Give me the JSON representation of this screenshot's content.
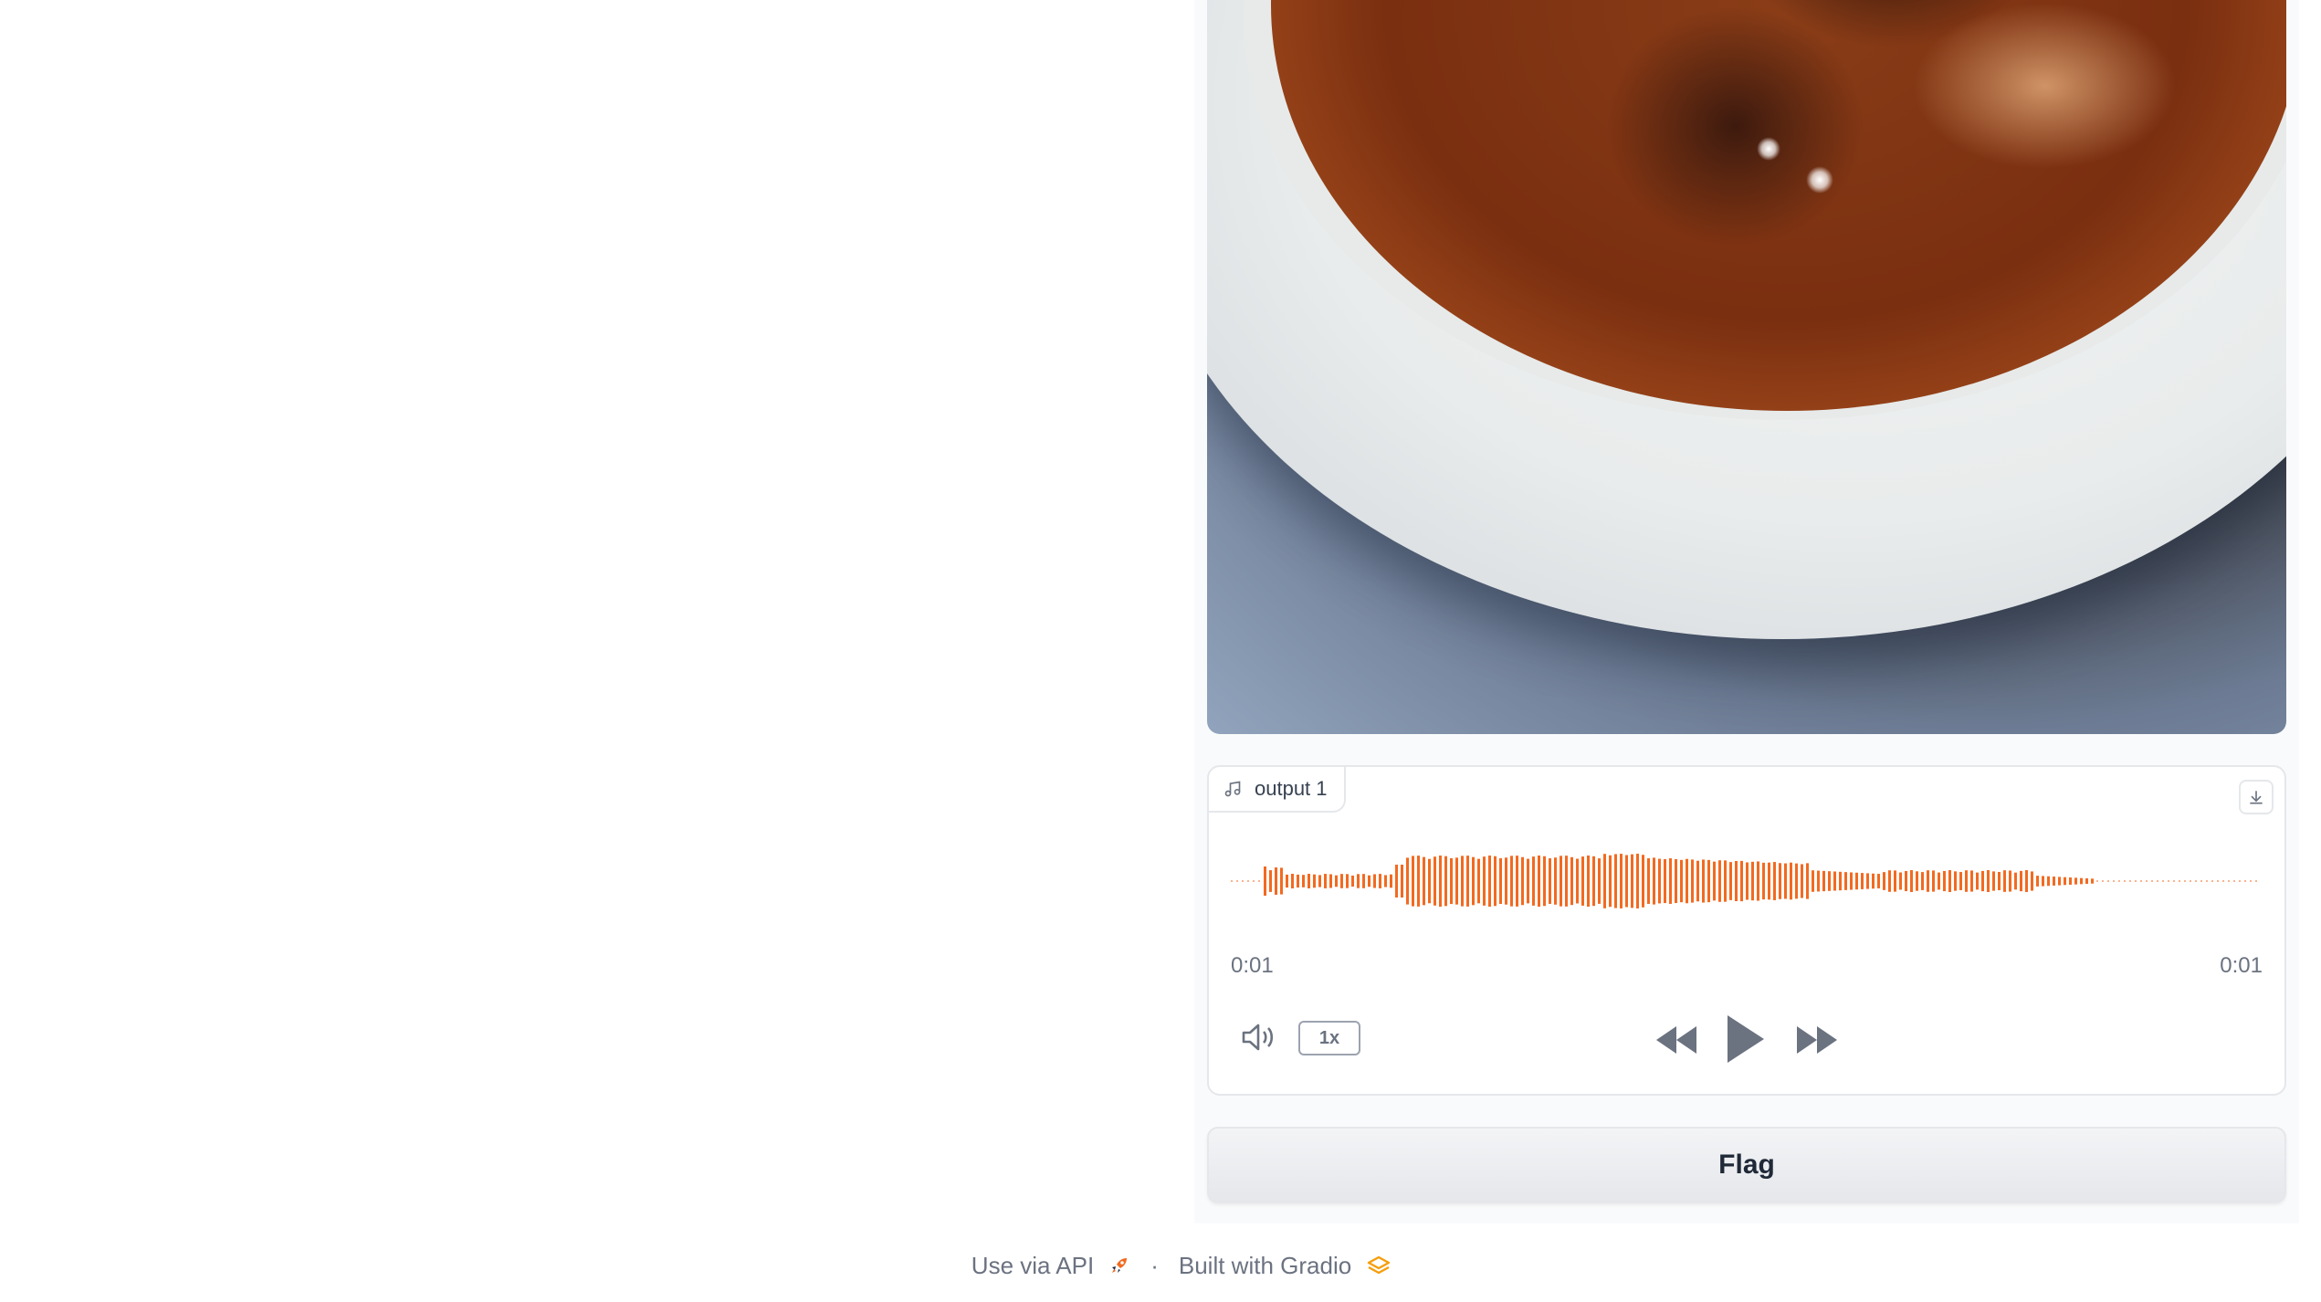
{
  "audio": {
    "label": "output 1",
    "time_current": "0:01",
    "time_total": "0:01",
    "speed": "1x",
    "waveform_color": "#f26a21"
  },
  "flag_button": "Flag",
  "footer": {
    "api_link": "Use via API",
    "separator": "·",
    "built_with": "Built with Gradio"
  }
}
